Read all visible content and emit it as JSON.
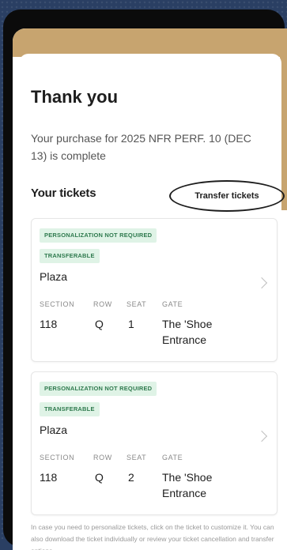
{
  "page": {
    "title": "Thank you",
    "subtitle": "Your purchase for 2025 NFR PERF. 10 (DEC 13) is complete",
    "tickets_heading": "Your tickets",
    "transfer_label": "Transfer tickets",
    "footer_text": "In case you need to personalize tickets, click on the ticket to customize it. You can also download the ticket individually or review your ticket cancellation and transfer options."
  },
  "labels": {
    "section": "SECTION",
    "row": "ROW",
    "seat": "SEAT",
    "gate": "GATE"
  },
  "tickets": [
    {
      "badge1": "PERSONALIZATION NOT REQUIRED",
      "badge2": "TRANSFERABLE",
      "venue": "Plaza",
      "section": "118",
      "row": "Q",
      "seat": "1",
      "gate": "The 'Shoe Entrance"
    },
    {
      "badge1": "PERSONALIZATION NOT REQUIRED",
      "badge2": "TRANSFERABLE",
      "venue": "Plaza",
      "section": "118",
      "row": "Q",
      "seat": "2",
      "gate": "The 'Shoe Entrance"
    }
  ],
  "colors": {
    "accent_tan": "#c7a46f",
    "badge_bg": "#dff3e6",
    "badge_text": "#2f7a4e"
  }
}
